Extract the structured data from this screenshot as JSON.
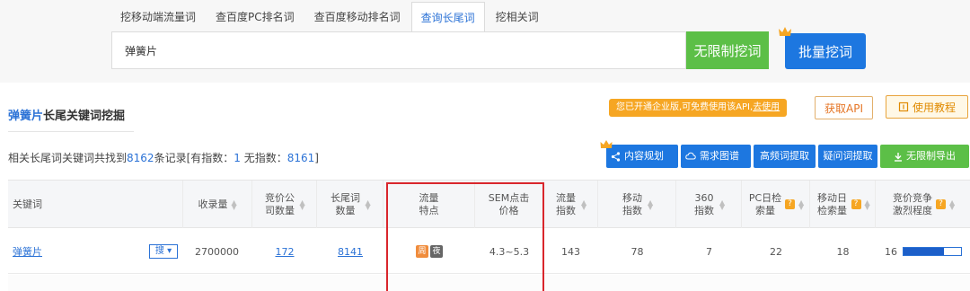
{
  "tabs": [
    {
      "label": "挖移动端流量词",
      "active": false
    },
    {
      "label": "查百度PC排名词",
      "active": false
    },
    {
      "label": "查百度移动排名词",
      "active": false
    },
    {
      "label": "查询长尾词",
      "active": true
    },
    {
      "label": "挖相关词",
      "active": false
    }
  ],
  "search": {
    "value": "弹簧片"
  },
  "buttons": {
    "unlimited": "无限制挖词",
    "batch": "批量挖词"
  },
  "section": {
    "keyword": "弹簧片",
    "title_suffix": "长尾关键词挖掘"
  },
  "notice": {
    "text": "您已开通企业版,可免费使用该API,",
    "link": "去使用"
  },
  "api_button": "获取API",
  "guide_button": "使用教程",
  "summary": {
    "prefix": "相关长尾词关键词共找到",
    "total": "8162",
    "mid1": "条记录[有指数：",
    "with_index": "1",
    "mid2": " 无指数：",
    "without_index": "8161",
    "suffix": "]"
  },
  "toolbar": [
    {
      "label": "内容规划",
      "icon": "share-icon"
    },
    {
      "label": "需求图谱",
      "icon": "cloud-icon"
    },
    {
      "label": "高频词提取",
      "icon": ""
    },
    {
      "label": "疑问词提取",
      "icon": ""
    },
    {
      "label": "无限制导出",
      "icon": "download-icon"
    }
  ],
  "columns": [
    {
      "key": "keyword",
      "label": "关键词"
    },
    {
      "key": "indexed",
      "label": "收录量"
    },
    {
      "key": "bid_companies",
      "label": "竞价公司数量"
    },
    {
      "key": "longtail",
      "label": "长尾词数量"
    },
    {
      "key": "traffic_feature",
      "label": "流量特点"
    },
    {
      "key": "sem_price",
      "label": "SEM点击价格"
    },
    {
      "key": "traffic_index",
      "label": "流量指数"
    },
    {
      "key": "mobile_index",
      "label": "移动指数"
    },
    {
      "key": "index_360",
      "label": "360指数"
    },
    {
      "key": "pc_daily",
      "label": "PC日检索量"
    },
    {
      "key": "mobile_daily",
      "label": "移动日检索量"
    },
    {
      "key": "competition",
      "label": "竞价竞争激烈程度"
    }
  ],
  "rows": [
    {
      "keyword": "弹簧片",
      "search_tag": "搜",
      "indexed": "2700000",
      "bid_companies": "172",
      "longtail": "8141",
      "traffic_feature": [
        "周",
        "夜"
      ],
      "sem_price": "4.3~5.3",
      "traffic_index": "143",
      "mobile_index": "78",
      "index_360": "7",
      "pc_daily": "22",
      "mobile_daily": "18",
      "competition": "16",
      "competition_level": 0.7
    }
  ],
  "colors": {
    "accent": "#2b72d6",
    "green": "#5cbf47",
    "orange": "#f6a623",
    "highlight": "#d9262c"
  }
}
